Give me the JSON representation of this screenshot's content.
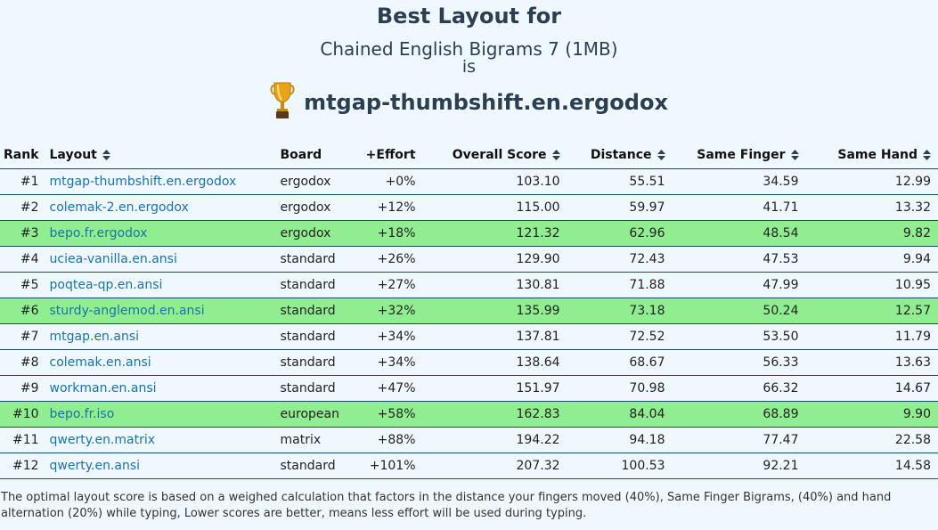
{
  "header": {
    "title": "Best Layout for",
    "corpus": "Chained English Bigrams 7 (1MB)",
    "is_label": "is",
    "winner": "mtgap-thumbshift.en.ergodox",
    "trophy_icon": "trophy-icon"
  },
  "table": {
    "columns": {
      "rank": "Rank",
      "layout": "Layout",
      "board": "Board",
      "effort": "+Effort",
      "overall": "Overall Score",
      "distance": "Distance",
      "same_finger": "Same Finger",
      "same_hand": "Same Hand"
    },
    "rows": [
      {
        "rank": "#1",
        "layout": "mtgap-thumbshift.en.ergodox",
        "board": "ergodox",
        "effort": "+0%",
        "overall": "103.10",
        "distance": "55.51",
        "same_finger": "34.59",
        "same_hand": "12.99",
        "highlight": false
      },
      {
        "rank": "#2",
        "layout": "colemak-2.en.ergodox",
        "board": "ergodox",
        "effort": "+12%",
        "overall": "115.00",
        "distance": "59.97",
        "same_finger": "41.71",
        "same_hand": "13.32",
        "highlight": false
      },
      {
        "rank": "#3",
        "layout": "bepo.fr.ergodox",
        "board": "ergodox",
        "effort": "+18%",
        "overall": "121.32",
        "distance": "62.96",
        "same_finger": "48.54",
        "same_hand": "9.82",
        "highlight": true
      },
      {
        "rank": "#4",
        "layout": "uciea-vanilla.en.ansi",
        "board": "standard",
        "effort": "+26%",
        "overall": "129.90",
        "distance": "72.43",
        "same_finger": "47.53",
        "same_hand": "9.94",
        "highlight": false
      },
      {
        "rank": "#5",
        "layout": "poqtea-qp.en.ansi",
        "board": "standard",
        "effort": "+27%",
        "overall": "130.81",
        "distance": "71.88",
        "same_finger": "47.99",
        "same_hand": "10.95",
        "highlight": false
      },
      {
        "rank": "#6",
        "layout": "sturdy-anglemod.en.ansi",
        "board": "standard",
        "effort": "+32%",
        "overall": "135.99",
        "distance": "73.18",
        "same_finger": "50.24",
        "same_hand": "12.57",
        "highlight": true
      },
      {
        "rank": "#7",
        "layout": "mtgap.en.ansi",
        "board": "standard",
        "effort": "+34%",
        "overall": "137.81",
        "distance": "72.52",
        "same_finger": "53.50",
        "same_hand": "11.79",
        "highlight": false
      },
      {
        "rank": "#8",
        "layout": "colemak.en.ansi",
        "board": "standard",
        "effort": "+34%",
        "overall": "138.64",
        "distance": "68.67",
        "same_finger": "56.33",
        "same_hand": "13.63",
        "highlight": false
      },
      {
        "rank": "#9",
        "layout": "workman.en.ansi",
        "board": "standard",
        "effort": "+47%",
        "overall": "151.97",
        "distance": "70.98",
        "same_finger": "66.32",
        "same_hand": "14.67",
        "highlight": false
      },
      {
        "rank": "#10",
        "layout": "bepo.fr.iso",
        "board": "european",
        "effort": "+58%",
        "overall": "162.83",
        "distance": "84.04",
        "same_finger": "68.89",
        "same_hand": "9.90",
        "highlight": true
      },
      {
        "rank": "#11",
        "layout": "qwerty.en.matrix",
        "board": "matrix",
        "effort": "+88%",
        "overall": "194.22",
        "distance": "94.18",
        "same_finger": "77.47",
        "same_hand": "22.58",
        "highlight": false
      },
      {
        "rank": "#12",
        "layout": "qwerty.en.ansi",
        "board": "standard",
        "effort": "+101%",
        "overall": "207.32",
        "distance": "100.53",
        "same_finger": "92.21",
        "same_hand": "14.58",
        "highlight": false
      }
    ]
  },
  "footer": {
    "text": "The optimal layout score is based on a weighed calculation that factors in the distance your fingers moved (40%), Same Finger Bigrams, (40%) and hand alternation (20%) while typing, Lower scores are better, means less effort will be used during typing."
  },
  "colors": {
    "background": "#f0f8ff",
    "highlight_row": "#90ee90",
    "link": "#1a73a8",
    "heading": "#2c3e50"
  }
}
